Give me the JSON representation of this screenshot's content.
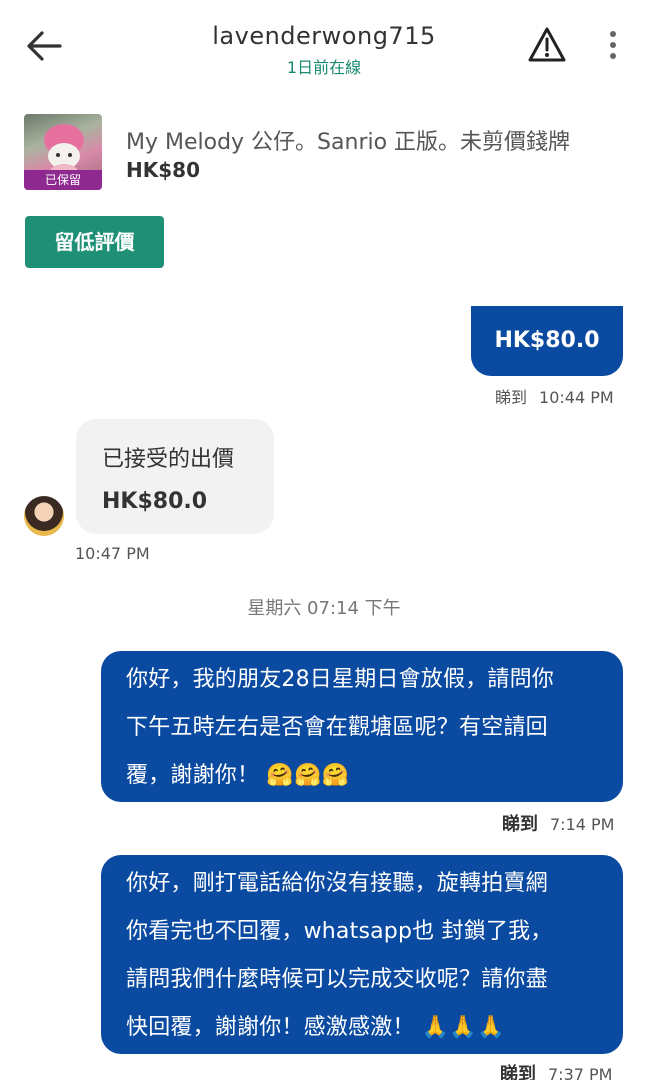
{
  "header": {
    "username": "lavenderwong715",
    "status": "1日前在線",
    "back_icon": "arrow-left-icon",
    "report_icon": "warning-triangle-icon",
    "menu_icon": "more-vertical-icon"
  },
  "listing": {
    "title": "My Melody 公仔。Sanrio 正版。未剪價錢牌",
    "price": "HK$80",
    "badge": "已保留"
  },
  "review_button": "留低評價",
  "messages": {
    "offer_out": {
      "text": "HK$80.0",
      "seen": "睇到",
      "time": "10:44 PM"
    },
    "offer_in": {
      "line1": "已接受的出價",
      "line2": "HK$80.0",
      "time": "10:47 PM"
    },
    "day_separator": "星期六 07:14 下午",
    "msg1": {
      "lines": [
        "你好，我的朋友28日星期日會放假，請問你",
        "下午五時左右是否會在觀塘區呢？有空請回",
        "覆，謝謝你！ 🤗🤗🤗"
      ],
      "seen": "睇到",
      "time": "7:14 PM"
    },
    "msg2": {
      "lines": [
        "你好，剛打電話給你沒有接聽，旋轉拍賣網",
        "你看完也不回覆，whatsapp也 封鎖了我，",
        "請問我們什麼時候可以完成交收呢？請你盡",
        "快回覆，謝謝你！感激感激！ 🙏🙏🙏"
      ],
      "seen": "睇到",
      "time": "7:37 PM"
    }
  },
  "colors": {
    "accent_green": "#1f8f75",
    "bubble_blue": "#0a4aa0",
    "reserved_purple": "#8e2a8f"
  }
}
